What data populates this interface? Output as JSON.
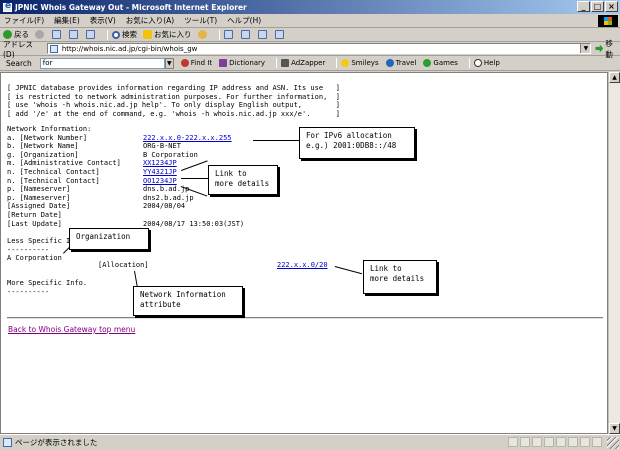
{
  "window": {
    "title": "JPNIC Whois Gateway Out - Microsoft Internet Explorer",
    "buttons": {
      "minimize": "_",
      "maximize": "□",
      "close": "×"
    }
  },
  "menu": [
    "ファイル(F)",
    "編集(E)",
    "表示(V)",
    "お気に入り(A)",
    "ツール(T)",
    "ヘルプ(H)"
  ],
  "toolbar": {
    "back": "戻る",
    "search": "検索",
    "favorites": "お気に入り"
  },
  "address": {
    "label": "アドレス(D)",
    "url": "http://whois.nic.ad.jp/cgi-bin/whois_gw",
    "go": "移動"
  },
  "searchbar": {
    "label": "Search",
    "value": "for",
    "items": [
      "Find It",
      "Dictionary",
      "AdZapper",
      "Smileys",
      "Travel",
      "Games",
      "Help"
    ]
  },
  "content": {
    "notice": [
      "[ JPNIC database provides information regarding IP address and ASN. Its use   ]",
      "[ is restricted to network administration purposes. For further information,  ]",
      "[ use 'whois -h whois.nic.ad.jp help'. To only display English output,        ]",
      "[ add '/e' at the end of command, e.g. 'whois -h whois.nic.ad.jp xxx/e'.      ]"
    ],
    "network_heading": "Network Information:",
    "fields": [
      {
        "label": "a. [Network Number]",
        "value": "222.x.x.0-222.x.x.255",
        "link": true
      },
      {
        "label": "b. [Network Name]",
        "value": "ORG-B-NET",
        "link": false
      },
      {
        "label": "g. [Organization]",
        "value": "B Corporation",
        "link": false
      },
      {
        "label": "m. [Administrative Contact]",
        "value": "XX1234JP",
        "link": true
      },
      {
        "label": "n. [Technical Contact]",
        "value": "YY4321JP",
        "link": true
      },
      {
        "label": "n. [Technical Contact]",
        "value": "OO1234JP",
        "link": true
      },
      {
        "label": "p. [Nameserver]",
        "value": "dns.b.ad.jp",
        "link": false
      },
      {
        "label": "p. [Nameserver]",
        "value": "dns2.b.ad.jp",
        "link": false
      },
      {
        "label": "[Assigned Date]",
        "value": "2004/08/04",
        "link": false
      },
      {
        "label": "[Return Date]",
        "value": "",
        "link": false
      },
      {
        "label": "[Last Update]",
        "value": "2004/08/17 13:50:03(JST)",
        "link": false
      }
    ],
    "less_specific": {
      "heading": "Less Specific Info.",
      "rule": "----------",
      "org": "A Corporation",
      "type": "[Allocation]",
      "range": "222.x.x.0/20"
    },
    "more_specific": {
      "heading": "More Specific Info.",
      "rule": "----------"
    },
    "back_link": "Back to Whois Gateway top menu"
  },
  "callouts": {
    "ipv6": "For IPv6 allocation\ne.g.) 2001:0DB8::/48",
    "details1": "Link to\nmore details",
    "organization": "Organization",
    "netinfo": "Network Information\nattribute",
    "details2": "Link to\nmore details"
  },
  "status": {
    "text": "ページが表示されました"
  }
}
